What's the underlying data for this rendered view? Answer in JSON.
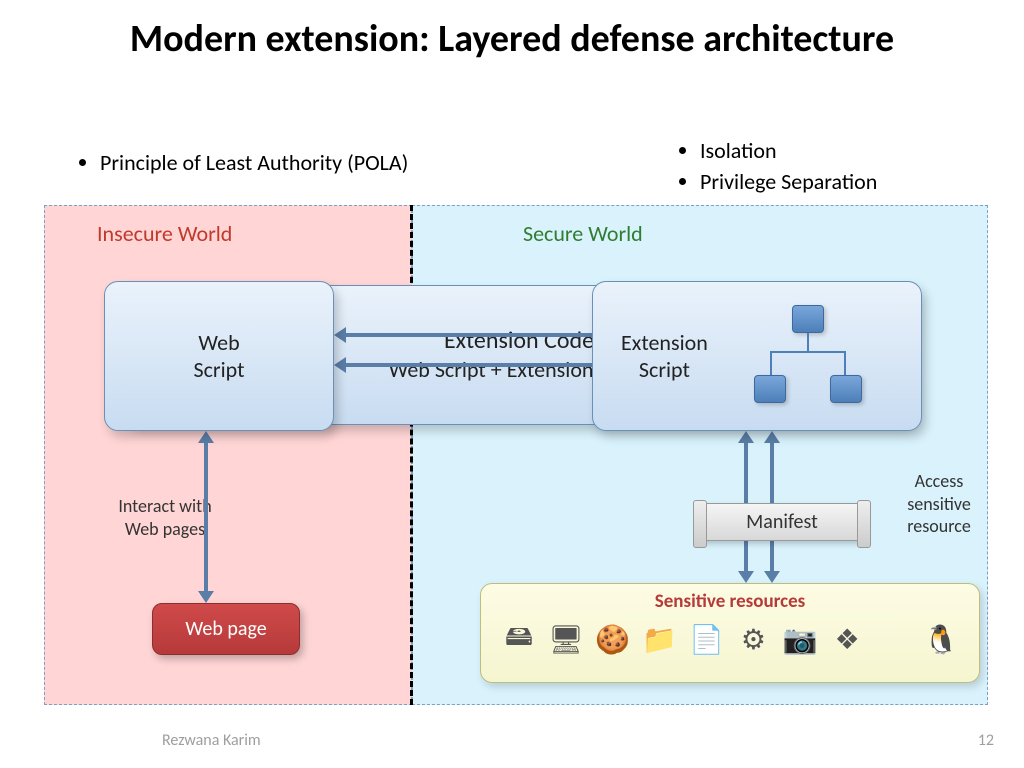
{
  "title": "Modern extension: Layered defense architecture",
  "bullets_left": [
    "Principle of Least Authority (POLA)"
  ],
  "bullets_right": [
    "Isolation",
    "Privilege Separation"
  ],
  "worlds": {
    "insecure": "Insecure World",
    "secure": "Secure World"
  },
  "boxes": {
    "core_line1": "Extension Code",
    "core_line2": "Web Script + Extension Script",
    "web_script": "Web\nScript",
    "ext_script": "Extension\nScript",
    "web_page": "Web page",
    "manifest": "Manifest",
    "sensitive_title": "Sensitive resources"
  },
  "labels": {
    "interact": "Interact with\nWeb pages",
    "access": "Access sensitive resource"
  },
  "resource_icons": [
    {
      "name": "harddrive-icon",
      "glyph": "🖴"
    },
    {
      "name": "globe-monitor-icon",
      "glyph": "🖥"
    },
    {
      "name": "cookie-icon",
      "glyph": "🍪"
    },
    {
      "name": "folder-icon",
      "glyph": "📁"
    },
    {
      "name": "file-icon",
      "glyph": "📄"
    },
    {
      "name": "gear-icon",
      "glyph": "⚙"
    },
    {
      "name": "camera-icon",
      "glyph": "📷"
    },
    {
      "name": "windows-icon",
      "glyph": "❖"
    },
    {
      "name": "apple-icon",
      "glyph": ""
    },
    {
      "name": "linux-tux-icon",
      "glyph": "🐧"
    }
  ],
  "footer": {
    "author": "Rezwana Karim",
    "page": "12"
  }
}
